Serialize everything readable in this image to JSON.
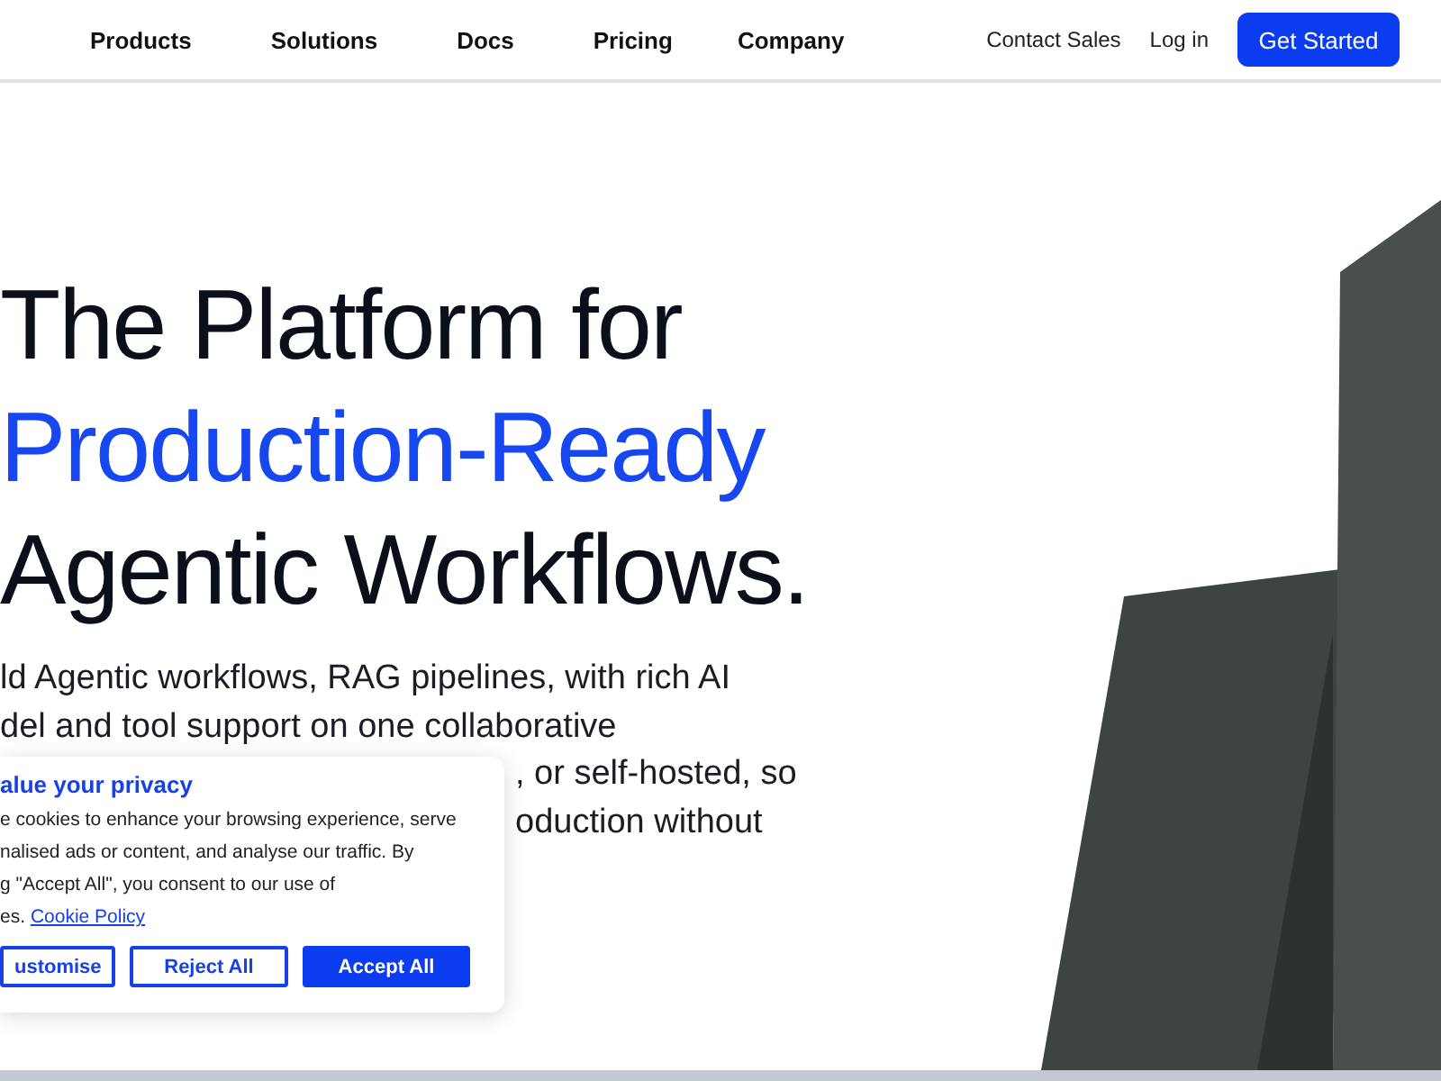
{
  "nav": {
    "links": [
      "Products",
      "Solutions",
      "Docs",
      "Pricing",
      "Company"
    ],
    "contact": "Contact Sales",
    "login": "Log in",
    "cta": "Get Started"
  },
  "hero": {
    "title_lines": [
      {
        "text": "The Platform for",
        "accent": false
      },
      {
        "text": "Production-Ready",
        "accent": true
      },
      {
        "text": "Agentic Workflows.",
        "accent": false
      }
    ],
    "body_lines": [
      "ld Agentic workflows, RAG pipelines, with rich AI",
      "del and tool support on one collaborative",
      ", or self-hosted, so",
      "oduction without"
    ]
  },
  "cookie_banner": {
    "title": "alue your privacy",
    "lines": [
      "e cookies to enhance your browsing experience, serve",
      "nalised ads or content, and analyse our traffic. By",
      "g \"Accept All\", you consent to our use of",
      "es."
    ],
    "link": "Cookie Policy",
    "buttons": [
      {
        "label": "ustomise",
        "kind": "outline"
      },
      {
        "label": "Reject All",
        "kind": "outline"
      },
      {
        "label": "Accept All",
        "kind": "filled"
      }
    ]
  }
}
